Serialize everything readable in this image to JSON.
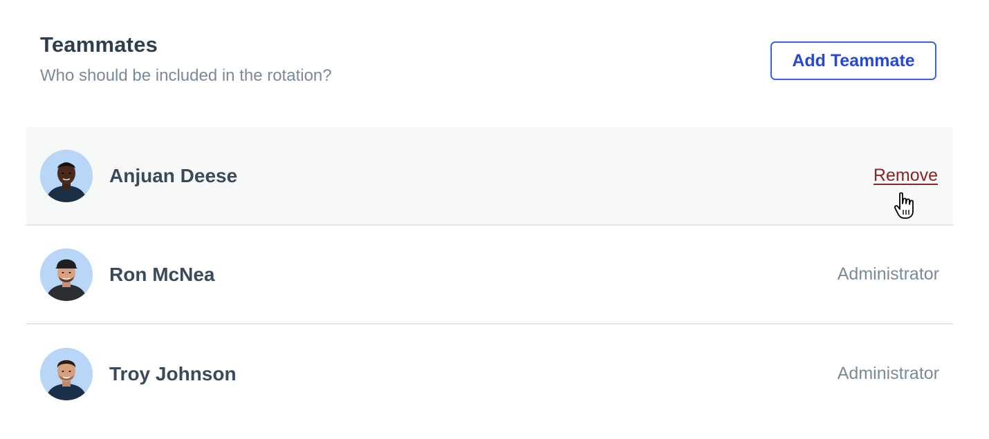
{
  "header": {
    "title": "Teammates",
    "subtitle": "Who should be included in the rotation?",
    "add_button_label": "Add Teammate"
  },
  "teammates": [
    {
      "name": "Anjuan Deese",
      "action_label": "Remove",
      "state": "hovered"
    },
    {
      "name": "Ron McNea",
      "role": "Administrator"
    },
    {
      "name": "Troy Johnson",
      "role": "Administrator"
    }
  ],
  "colors": {
    "accent": "#2747d6",
    "remove": "#8a2323",
    "avatar_bg": "#b8d6f7",
    "hover_row_bg": "#f7f9f9"
  }
}
